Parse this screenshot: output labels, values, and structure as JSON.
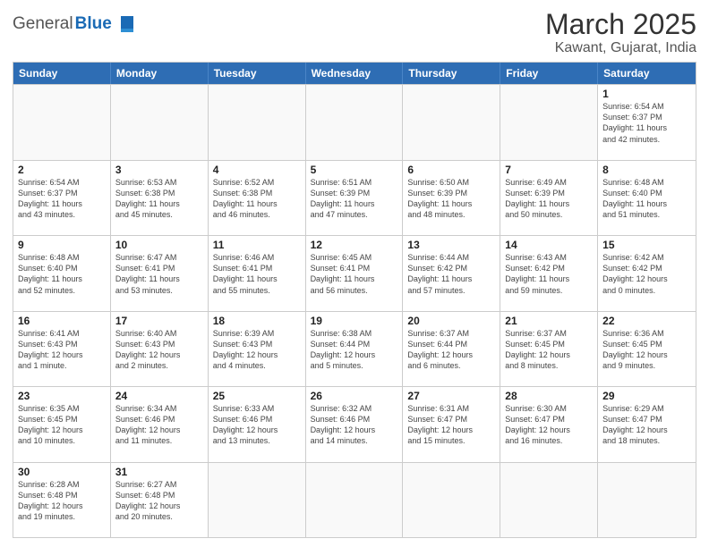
{
  "header": {
    "logo_general": "General",
    "logo_blue": "Blue",
    "title": "March 2025",
    "subtitle": "Kawant, Gujarat, India"
  },
  "weekdays": [
    "Sunday",
    "Monday",
    "Tuesday",
    "Wednesday",
    "Thursday",
    "Friday",
    "Saturday"
  ],
  "weeks": [
    [
      {
        "day": "",
        "info": ""
      },
      {
        "day": "",
        "info": ""
      },
      {
        "day": "",
        "info": ""
      },
      {
        "day": "",
        "info": ""
      },
      {
        "day": "",
        "info": ""
      },
      {
        "day": "",
        "info": ""
      },
      {
        "day": "1",
        "info": "Sunrise: 6:54 AM\nSunset: 6:37 PM\nDaylight: 11 hours\nand 42 minutes."
      }
    ],
    [
      {
        "day": "2",
        "info": "Sunrise: 6:54 AM\nSunset: 6:37 PM\nDaylight: 11 hours\nand 43 minutes."
      },
      {
        "day": "3",
        "info": "Sunrise: 6:53 AM\nSunset: 6:38 PM\nDaylight: 11 hours\nand 45 minutes."
      },
      {
        "day": "4",
        "info": "Sunrise: 6:52 AM\nSunset: 6:38 PM\nDaylight: 11 hours\nand 46 minutes."
      },
      {
        "day": "5",
        "info": "Sunrise: 6:51 AM\nSunset: 6:39 PM\nDaylight: 11 hours\nand 47 minutes."
      },
      {
        "day": "6",
        "info": "Sunrise: 6:50 AM\nSunset: 6:39 PM\nDaylight: 11 hours\nand 48 minutes."
      },
      {
        "day": "7",
        "info": "Sunrise: 6:49 AM\nSunset: 6:39 PM\nDaylight: 11 hours\nand 50 minutes."
      },
      {
        "day": "8",
        "info": "Sunrise: 6:48 AM\nSunset: 6:40 PM\nDaylight: 11 hours\nand 51 minutes."
      }
    ],
    [
      {
        "day": "9",
        "info": "Sunrise: 6:48 AM\nSunset: 6:40 PM\nDaylight: 11 hours\nand 52 minutes."
      },
      {
        "day": "10",
        "info": "Sunrise: 6:47 AM\nSunset: 6:41 PM\nDaylight: 11 hours\nand 53 minutes."
      },
      {
        "day": "11",
        "info": "Sunrise: 6:46 AM\nSunset: 6:41 PM\nDaylight: 11 hours\nand 55 minutes."
      },
      {
        "day": "12",
        "info": "Sunrise: 6:45 AM\nSunset: 6:41 PM\nDaylight: 11 hours\nand 56 minutes."
      },
      {
        "day": "13",
        "info": "Sunrise: 6:44 AM\nSunset: 6:42 PM\nDaylight: 11 hours\nand 57 minutes."
      },
      {
        "day": "14",
        "info": "Sunrise: 6:43 AM\nSunset: 6:42 PM\nDaylight: 11 hours\nand 59 minutes."
      },
      {
        "day": "15",
        "info": "Sunrise: 6:42 AM\nSunset: 6:42 PM\nDaylight: 12 hours\nand 0 minutes."
      }
    ],
    [
      {
        "day": "16",
        "info": "Sunrise: 6:41 AM\nSunset: 6:43 PM\nDaylight: 12 hours\nand 1 minute."
      },
      {
        "day": "17",
        "info": "Sunrise: 6:40 AM\nSunset: 6:43 PM\nDaylight: 12 hours\nand 2 minutes."
      },
      {
        "day": "18",
        "info": "Sunrise: 6:39 AM\nSunset: 6:43 PM\nDaylight: 12 hours\nand 4 minutes."
      },
      {
        "day": "19",
        "info": "Sunrise: 6:38 AM\nSunset: 6:44 PM\nDaylight: 12 hours\nand 5 minutes."
      },
      {
        "day": "20",
        "info": "Sunrise: 6:37 AM\nSunset: 6:44 PM\nDaylight: 12 hours\nand 6 minutes."
      },
      {
        "day": "21",
        "info": "Sunrise: 6:37 AM\nSunset: 6:45 PM\nDaylight: 12 hours\nand 8 minutes."
      },
      {
        "day": "22",
        "info": "Sunrise: 6:36 AM\nSunset: 6:45 PM\nDaylight: 12 hours\nand 9 minutes."
      }
    ],
    [
      {
        "day": "23",
        "info": "Sunrise: 6:35 AM\nSunset: 6:45 PM\nDaylight: 12 hours\nand 10 minutes."
      },
      {
        "day": "24",
        "info": "Sunrise: 6:34 AM\nSunset: 6:46 PM\nDaylight: 12 hours\nand 11 minutes."
      },
      {
        "day": "25",
        "info": "Sunrise: 6:33 AM\nSunset: 6:46 PM\nDaylight: 12 hours\nand 13 minutes."
      },
      {
        "day": "26",
        "info": "Sunrise: 6:32 AM\nSunset: 6:46 PM\nDaylight: 12 hours\nand 14 minutes."
      },
      {
        "day": "27",
        "info": "Sunrise: 6:31 AM\nSunset: 6:47 PM\nDaylight: 12 hours\nand 15 minutes."
      },
      {
        "day": "28",
        "info": "Sunrise: 6:30 AM\nSunset: 6:47 PM\nDaylight: 12 hours\nand 16 minutes."
      },
      {
        "day": "29",
        "info": "Sunrise: 6:29 AM\nSunset: 6:47 PM\nDaylight: 12 hours\nand 18 minutes."
      }
    ],
    [
      {
        "day": "30",
        "info": "Sunrise: 6:28 AM\nSunset: 6:48 PM\nDaylight: 12 hours\nand 19 minutes."
      },
      {
        "day": "31",
        "info": "Sunrise: 6:27 AM\nSunset: 6:48 PM\nDaylight: 12 hours\nand 20 minutes."
      },
      {
        "day": "",
        "info": ""
      },
      {
        "day": "",
        "info": ""
      },
      {
        "day": "",
        "info": ""
      },
      {
        "day": "",
        "info": ""
      },
      {
        "day": "",
        "info": ""
      }
    ]
  ]
}
